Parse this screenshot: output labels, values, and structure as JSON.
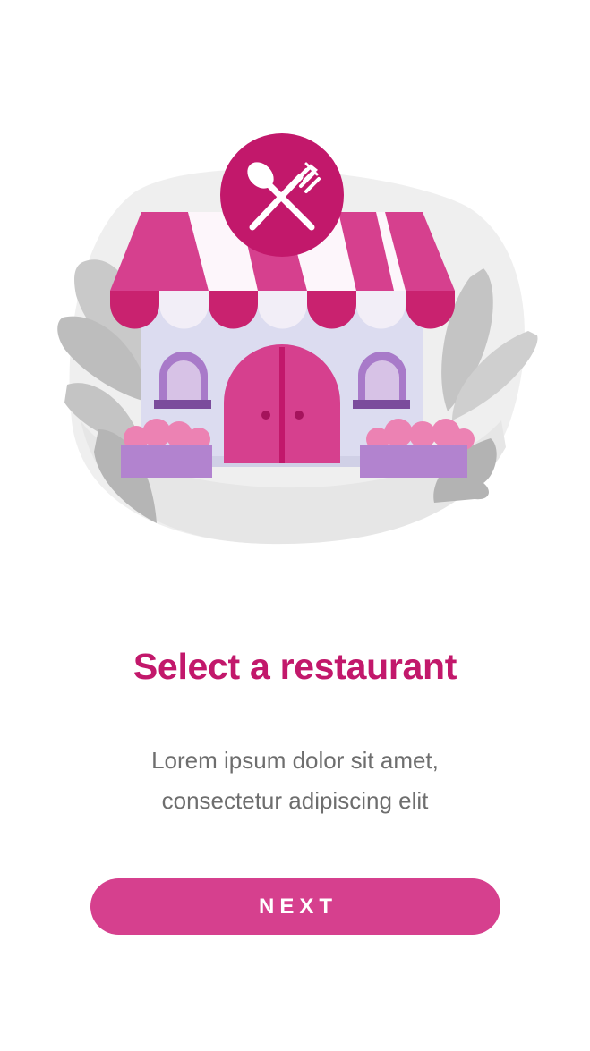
{
  "onboarding": {
    "title": "Select a restaurant",
    "description_line1": "Lorem ipsum dolor sit amet,",
    "description_line2": "consectetur adipiscing elit",
    "next_label": "NEXT"
  },
  "illustration": {
    "icon": "fork-spoon-icon"
  },
  "colors": {
    "accent": "#c2186b",
    "button": "#d6408e",
    "awning_pink": "#d6408e",
    "awning_white": "#fdf6fb",
    "wall": "#dcdcf0",
    "text_muted": "#6e6e6e"
  }
}
